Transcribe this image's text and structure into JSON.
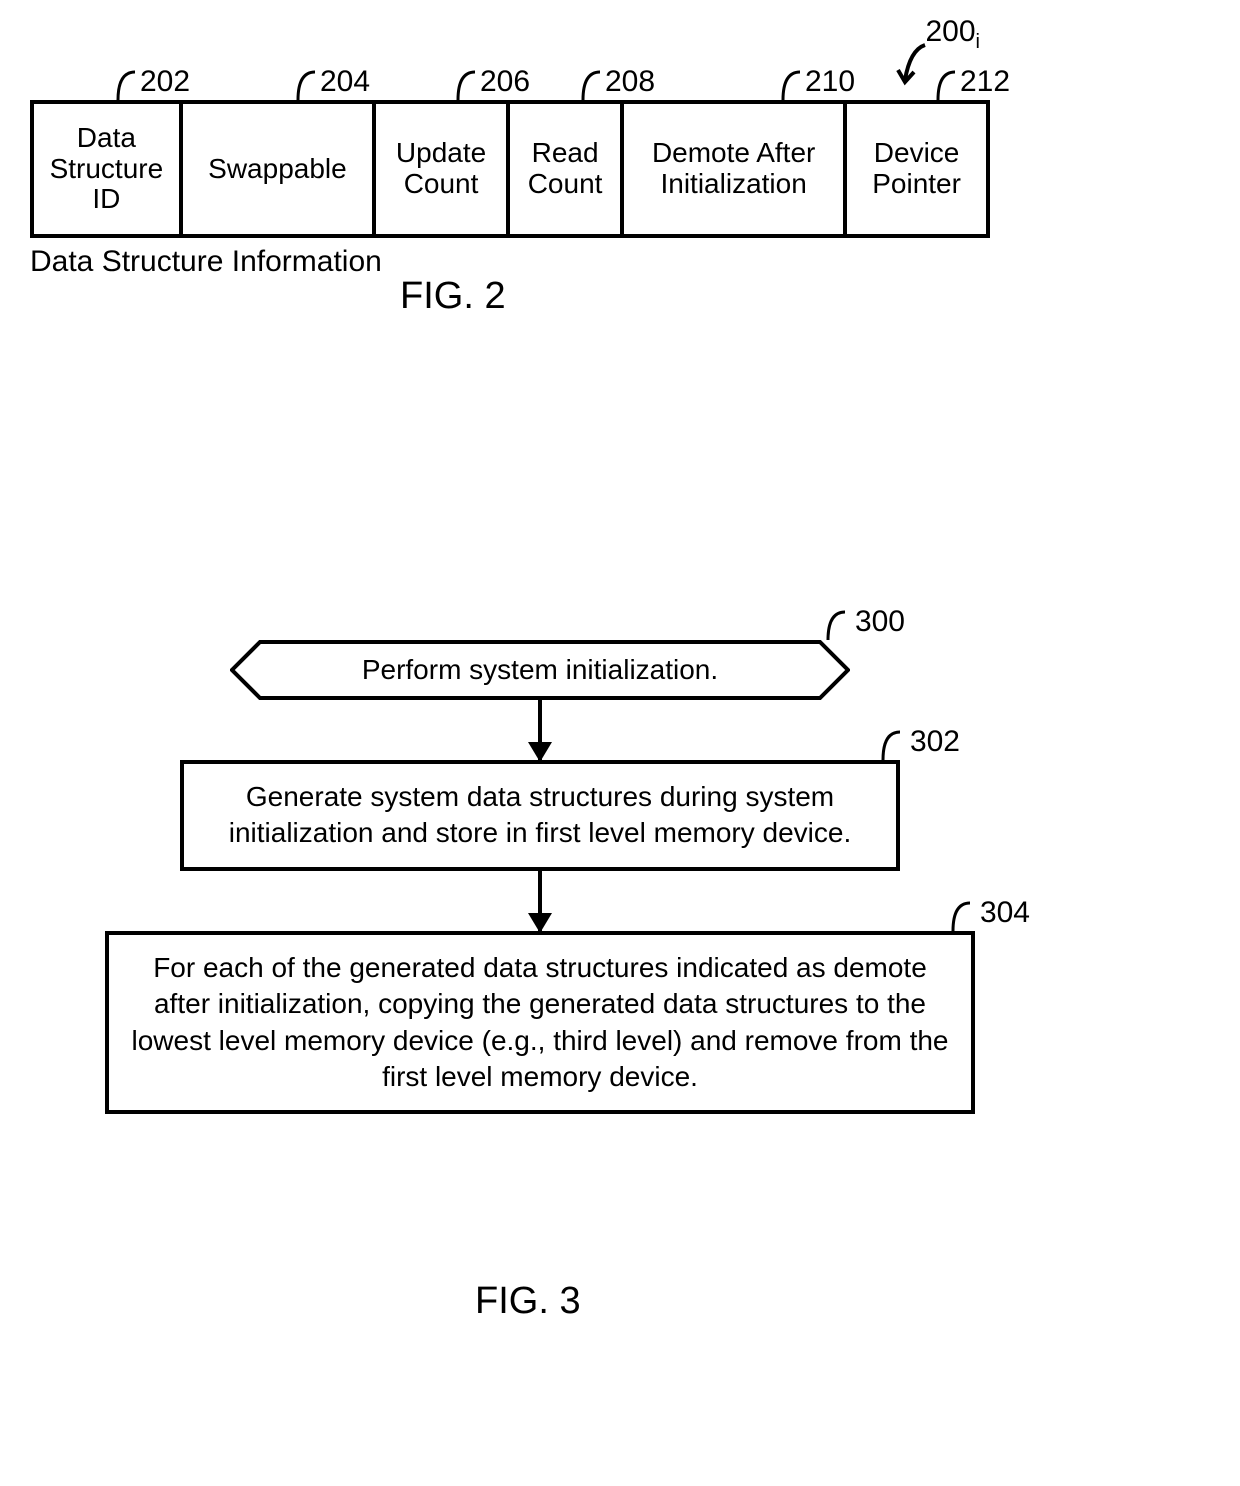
{
  "fig2": {
    "ref_main": "200",
    "ref_main_sub": "i",
    "cells": [
      {
        "ref": "202",
        "text": "Data\nStructure\nID"
      },
      {
        "ref": "204",
        "text": "Swappable"
      },
      {
        "ref": "206",
        "text": "Update\nCount"
      },
      {
        "ref": "208",
        "text": "Read\nCount"
      },
      {
        "ref": "210",
        "text": "Demote After\nInitialization"
      },
      {
        "ref": "212",
        "text": "Device\nPointer"
      }
    ],
    "caption": "Data Structure Information",
    "figure_label": "FIG. 2"
  },
  "fig3": {
    "steps": [
      {
        "ref": "300",
        "text": "Perform system initialization."
      },
      {
        "ref": "302",
        "text": "Generate system data structures during system initialization and store in first level memory device."
      },
      {
        "ref": "304",
        "text": "For each of the generated data structures indicated as demote after initialization, copying the generated data structures to the lowest level memory device (e.g., third level) and remove from the first level memory device."
      }
    ],
    "figure_label": "FIG. 3"
  }
}
